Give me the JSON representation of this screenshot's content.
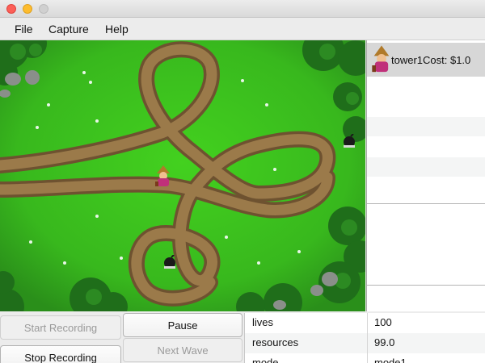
{
  "window": {
    "controls": [
      "close",
      "minimize",
      "maximize"
    ]
  },
  "menu": {
    "items": [
      "File",
      "Capture",
      "Help"
    ]
  },
  "store": {
    "items": [
      {
        "icon": "wizard-tower-icon",
        "label": "tower1Cost: $1.0"
      }
    ]
  },
  "controls": {
    "start_recording": "Start Recording",
    "stop_recording": "Stop Recording",
    "pause": "Pause",
    "next_wave": "Next Wave"
  },
  "stats": {
    "rows": [
      {
        "key": "lives",
        "value": "100"
      },
      {
        "key": "resources",
        "value": "99.0"
      },
      {
        "key": "mode",
        "value": "mode1"
      }
    ]
  },
  "colors": {
    "grass": "#3fbf22",
    "path": "#8a6a3a",
    "store_selected": "#d7d7d7"
  }
}
